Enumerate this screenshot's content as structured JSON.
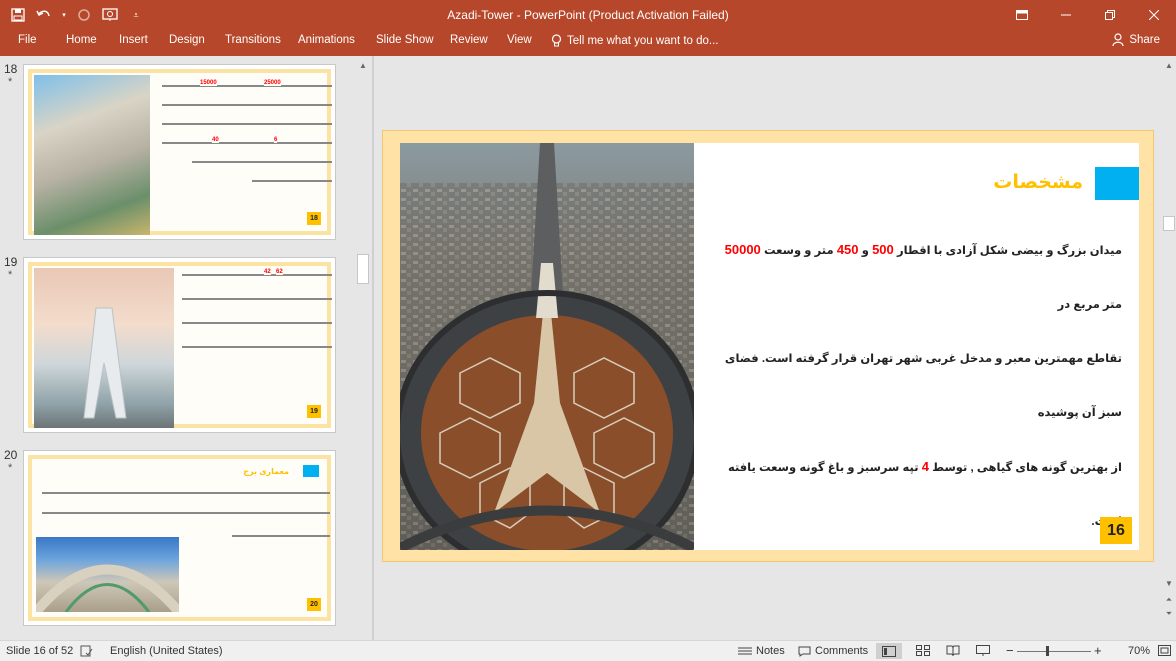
{
  "app": {
    "title": "Azadi-Tower - PowerPoint (Product Activation Failed)",
    "accent_color": "#b7472a",
    "qat_icons": [
      "save-icon",
      "undo-icon",
      "redo-icon",
      "start-from-beginning-icon",
      "customize-qat-icon"
    ],
    "window_controls": [
      "ribbon-display-options-icon",
      "minimize-icon",
      "restore-icon",
      "close-icon"
    ]
  },
  "ribbon": {
    "tabs": [
      "File",
      "Home",
      "Insert",
      "Design",
      "Transitions",
      "Animations",
      "Slide Show",
      "Review",
      "View"
    ],
    "tell_me": "Tell me what you want to do...",
    "share": "Share"
  },
  "thumbnails": [
    {
      "number": "18",
      "star": "*",
      "badge": "18",
      "highlights": [
        "25000",
        "15000",
        "6",
        "40"
      ]
    },
    {
      "number": "19",
      "star": "*",
      "badge": "19",
      "highlights": [
        "42",
        "62"
      ]
    },
    {
      "number": "20",
      "star": "*",
      "badge": "20",
      "title": "معماری برج"
    }
  ],
  "slide": {
    "heading": "مشخصات",
    "line1_a": "میدان بزرگ و بیضی شکل آزادی با اقطار ",
    "line1_n1": "500",
    "line1_b": " و ",
    "line1_n2": "450",
    "line1_c": " متر و وسعت ",
    "line1_n3": "50000",
    "line1_d": " متر مربع در",
    "line2": "تقاطع مهمترین معبر و مدخل غربی شهر تهران قرار گرفته است. فضای سبز آن پوشیده",
    "line3_a": "از بهترین گونه های گیاهی , توسط ",
    "line3_n": "4",
    "line3_b": " تپه سرسبز و باغ گونه وسعت یافته است.",
    "page_number": "16",
    "heading_color": "#ffc000",
    "number_color": "#ff0000",
    "accent_box_color": "#00b0f0"
  },
  "status": {
    "slide_info": "Slide 16 of 52",
    "language": "English (United States)",
    "notes": "Notes",
    "comments": "Comments",
    "zoom": "70%",
    "zoom_value_percent": 70
  }
}
